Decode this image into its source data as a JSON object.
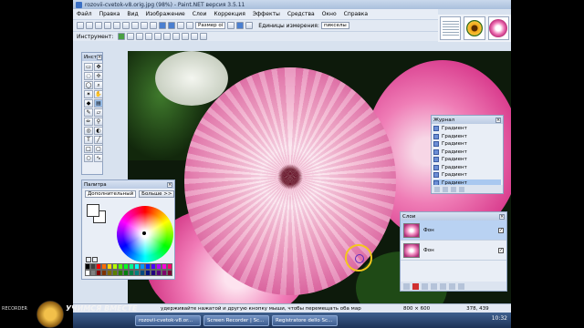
{
  "window": {
    "title": "rozovii-cvetok-v8.orig.jpg (98%) - Paint.NET версия 3.5.11"
  },
  "menu": [
    "Файл",
    "Правка",
    "Вид",
    "Изображение",
    "Слои",
    "Коррекция",
    "Эффекты",
    "Средства",
    "Окно",
    "Справка"
  ],
  "toolbar": {
    "size_label": "Размер оі",
    "units_label": "Единицы измерения:",
    "units_value": "пикселы",
    "tool_label": "Инструмент:"
  },
  "tools_panel": {
    "title": "Инст"
  },
  "palette": {
    "title": "Палитра",
    "mode": "Дополнительный",
    "more_button": "Больше >>",
    "colors": [
      "#000000",
      "#404040",
      "#ff0000",
      "#ff6a00",
      "#ffd800",
      "#b6ff00",
      "#4cff00",
      "#00ff21",
      "#00ff90",
      "#00ffff",
      "#0094ff",
      "#0026ff",
      "#4800ff",
      "#b200ff",
      "#ff00dc",
      "#ff006e",
      "#ffffff",
      "#808080",
      "#7f0000",
      "#7f3300",
      "#7f6a00",
      "#5b7f00",
      "#267f00",
      "#007f0e",
      "#007f46",
      "#007f7f",
      "#004a7f",
      "#00137f",
      "#21007f",
      "#57007f",
      "#7f006e",
      "#7f0037"
    ]
  },
  "history": {
    "title": "Журнал",
    "items": [
      "Градиент",
      "Градиент",
      "Градиент",
      "Градиент",
      "Градиент",
      "Градиент",
      "Градиент",
      "Градиент"
    ]
  },
  "layers": {
    "title": "Слои",
    "items": [
      {
        "name": "Фон",
        "checked": true
      },
      {
        "name": "Фон",
        "checked": true
      }
    ]
  },
  "status": {
    "hint": "удерживайте нажатой и другую кнопку мыши, чтобы перемещать оба мар",
    "image_size": "800 × 600",
    "cursor_pos": "378, 439"
  },
  "taskbar": {
    "items": [
      "rozovii-cvetok-v8.or...",
      "Screen Recorder | Sc...",
      "Registratore dello Sc..."
    ],
    "clock": "10:32"
  },
  "watermark": {
    "title": "УЧИМСЯ ВМЕСТЕ",
    "left_text": "RECORDER"
  }
}
